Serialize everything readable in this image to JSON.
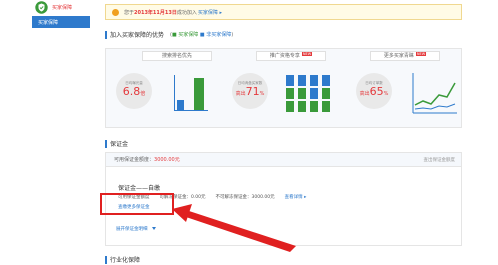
{
  "sidebar": {
    "title": "买家保障",
    "item": "买家保障"
  },
  "notice": {
    "prefix": "您于",
    "date": "2013年11月13日",
    "suffix": "成功加入",
    "link": "买家保障 ▸"
  },
  "advantage": {
    "title": "加入买家保障的优势",
    "legend_green": "■ 买家保障",
    "legend_blue": "■ 非买家保障",
    "tabs": [
      "搜索排名优先",
      "推广资格专享",
      "更多买家青睐"
    ],
    "new_badge": "NEW",
    "circles": [
      {
        "caption": "日均曝光量",
        "value": "6.8",
        "unit": "倍"
      },
      {
        "caption": "日均询盘买家数",
        "value": "71",
        "prefix": "高出",
        "unit": "%"
      },
      {
        "caption": "日均订单数",
        "value": "65",
        "prefix": "高出",
        "unit": "%"
      }
    ],
    "illustration_values": {
      "bars": [
        0.3,
        1.0
      ],
      "people": [
        "blue",
        "blue",
        "blue",
        "blue",
        "green",
        "green",
        "blue",
        "green",
        "green",
        "green",
        "green",
        "green"
      ]
    }
  },
  "guarantee": {
    "title": "保证金",
    "usable_label": "可用保证金额度：",
    "usable_value": "3000.00元",
    "head_link": "查出保证金额度",
    "name": "保证金——自缴",
    "row_label_1": "可用保证金额度",
    "row_label_2": "可解冻保证金：0.00元",
    "row_label_3": "不可解冻保证金：3000.00元",
    "row_link": "查看详情 ▸",
    "more_link": "查缴更多保证金",
    "expand_link": "展开保证金明细"
  },
  "industry": {
    "title": "行业化保障"
  },
  "colors": {
    "accent_blue": "#2e7acc",
    "accent_red": "#e4393c",
    "green": "#3a9a3a",
    "annotation_red": "#e02020"
  }
}
